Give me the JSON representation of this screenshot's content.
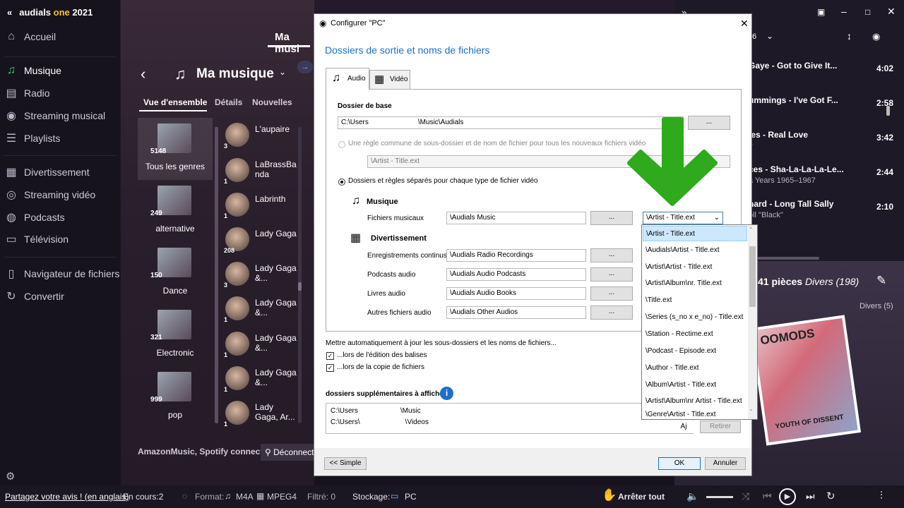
{
  "app": {
    "name_prefix": "audials ",
    "name_one": "one",
    "name_year": " 2021"
  },
  "sidebar": {
    "items": [
      {
        "label": "Accueil",
        "icon": "home-icon"
      },
      {
        "label": "Musique",
        "icon": "music-note-icon"
      },
      {
        "label": "Radio",
        "icon": "radio-icon"
      },
      {
        "label": "Streaming musical",
        "icon": "streaming-icon"
      },
      {
        "label": "Playlists",
        "icon": "playlist-icon"
      },
      {
        "label": "Divertissement",
        "icon": "film-icon"
      },
      {
        "label": "Streaming vidéo",
        "icon": "video-stream-icon"
      },
      {
        "label": "Podcasts",
        "icon": "podcast-icon"
      },
      {
        "label": "Télévision",
        "icon": "tv-icon"
      },
      {
        "label": "Navigateur de fichiers",
        "icon": "folder-icon"
      },
      {
        "label": "Convertir",
        "icon": "convert-icon"
      }
    ],
    "feedback": "Partagez votre avis ! (en anglais)"
  },
  "middle": {
    "tab_partial": "Ma musi",
    "title": "Ma musique",
    "subtabs": [
      "Vue d'ensemble",
      "Détails",
      "Nouvelles"
    ],
    "genres": [
      {
        "count": "5148",
        "name": "Tous les genres"
      },
      {
        "count": "249",
        "name": "alternative"
      },
      {
        "count": "150",
        "name": "Dance"
      },
      {
        "count": "321",
        "name": "Electronic"
      },
      {
        "count": "999",
        "name": "pop"
      }
    ],
    "artists": [
      {
        "name": "L'aupaire",
        "count": "3"
      },
      {
        "name": "LaBrassBa nda",
        "count": "1"
      },
      {
        "name": "Labrinth",
        "count": "1"
      },
      {
        "name": "Lady Gaga",
        "count": "208"
      },
      {
        "name": "Lady Gaga &...",
        "count": "3"
      },
      {
        "name": "Lady Gaga &...",
        "count": "1"
      },
      {
        "name": "Lady Gaga &...",
        "count": "1"
      },
      {
        "name": "Lady Gaga &...",
        "count": "1"
      },
      {
        "name": "Lady Gaga, Ar...",
        "count": "1"
      }
    ],
    "connected": "AmazonMusic, Spotify connecté",
    "disconnect": "Déconnect"
  },
  "right": {
    "tracks": [
      {
        "title": "Gaye - Got to Give It...",
        "sub": "",
        "dur": "4:02"
      },
      {
        "title": "ummings - I've Got F...",
        "sub": "",
        "dur": "2:58"
      },
      {
        "title": "les - Real Love",
        "sub": "y",
        "dur": "3:42"
      },
      {
        "title": "ces - Sha-La-La-La-Le...",
        "sub": "a Years 1965–1967",
        "dur": "2:44"
      },
      {
        "title": "hard - Long Tall Sally",
        "sub": "oll \"Black\"",
        "dur": "2:10"
      }
    ],
    "pieces": "41 pièces",
    "divers": "Divers (198)",
    "divers_small": "Divers (5)",
    "album_text1": "OOMODS",
    "album_text2": "YOUTH OF DISSENT",
    "page_indicator": "6"
  },
  "bottombar": {
    "encours": "En cours:",
    "encours_val": "2",
    "format": "Format:",
    "format_audio": "M4A",
    "format_video": "MPEG4",
    "filtre": "Filtré: 0",
    "stockage": "Stockage:",
    "stockage_val": "PC",
    "stop": "Arrêter tout"
  },
  "dialog": {
    "title": "Configurer \"PC\"",
    "heading": "Dossiers de sortie et noms de fichiers",
    "tabs": [
      "Audio",
      "Vidéo"
    ],
    "base_label": "Dossier de base",
    "base_path_a": "C:\\Users",
    "base_path_b": "\\Music\\Audials",
    "browse": "...",
    "rule_common": "Une règle commune de sous-dossier et de nom de fichier pour tous les nouveaux fichiers vidéo",
    "rule_common_value": "\\Artist - Title.ext",
    "rule_separate": "Dossiers et règles séparés pour chaque type de fichier vidéo",
    "section_music": "Musique",
    "music_label": "Fichiers musicaux",
    "music_path": "\\Audials Music",
    "music_pattern": "\\Artist - Title.ext",
    "section_ent": "Divertissement",
    "ent_rows": [
      {
        "label": "Enregistrements continus",
        "path": "\\Audials Radio Recordings"
      },
      {
        "label": "Podcasts audio",
        "path": "\\Audials Audio Podcasts"
      },
      {
        "label": "Livres audio",
        "path": "\\Audials Audio Books"
      },
      {
        "label": "Autres fichiers audio",
        "path": "\\Audials Other Audios"
      }
    ],
    "auto_update": "Mettre automatiquement à jour les sous-dossiers et les noms de fichiers...",
    "chk1": "...lors de l'édition des balises",
    "chk2": "...lors de la copie de fichiers",
    "extra_label": "dossiers supplémentaires à afficher",
    "extra_paths": [
      {
        "a": "C:\\Users",
        "b": "\\Music"
      },
      {
        "a": "C:\\Users\\",
        "b": "\\Videos"
      }
    ],
    "btn_add": "Aj",
    "btn_remove": "Retirer",
    "btn_simple": "<< Simple",
    "btn_ok": "OK",
    "btn_cancel": "Annuler",
    "dropdown_options": [
      "\\Artist - Title.ext",
      "\\Audials\\Artist - Title.ext",
      "\\Artist\\Artist - Title.ext",
      "\\Artist\\Album\\nr. Title.ext",
      "\\Title.ext",
      "\\Series (s_no x e_no) - Title.ext",
      "\\Station - Rectime.ext",
      "\\Podcast - Episode.ext",
      "\\Author - Title.ext",
      "\\Album\\Artist - Title.ext",
      "\\Artist\\Album\\nr Artist - Title.ext",
      "\\Genre\\Artist - Title.ext"
    ]
  },
  "colors": {
    "accent_green": "#3fd17a",
    "arrow_green": "#2eaa1c",
    "dialog_blue": "#1a6fc7",
    "audials_yellow": "#f5c518"
  }
}
